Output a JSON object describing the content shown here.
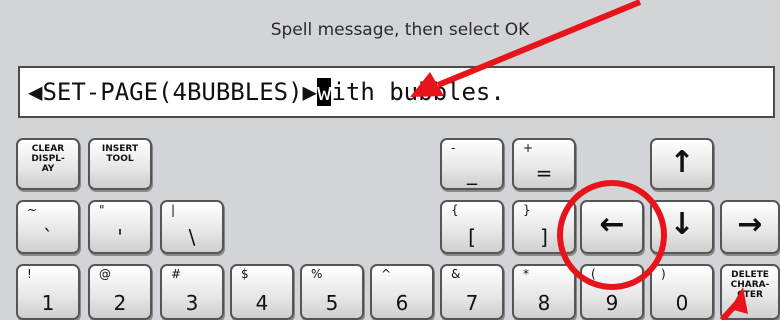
{
  "title": "Spell message, then select OK",
  "message": {
    "prefix": "◀SET-PAGE(4BUBBLES)▶",
    "cursor_char": "w",
    "suffix": "ith bubbles."
  },
  "keys": {
    "clear_display": "CLEAR\nDISPL-\nAY",
    "insert_tool": "INSERT\nTOOL",
    "minus": {
      "shift": "-",
      "main": "_"
    },
    "plus": {
      "shift": "+",
      "main": "="
    },
    "up": "↑",
    "tilde": {
      "shift": "~",
      "main": "`"
    },
    "quote": {
      "shift": "\"",
      "main": "'"
    },
    "pipe": {
      "shift": "|",
      "main": "\\"
    },
    "brace_open": {
      "shift": "{",
      "main": "["
    },
    "brace_close": {
      "shift": "}",
      "main": "]"
    },
    "left": "←",
    "down": "↓",
    "right": "→",
    "n1": {
      "shift": "!",
      "main": "1"
    },
    "n2": {
      "shift": "@",
      "main": "2"
    },
    "n3": {
      "shift": "#",
      "main": "3"
    },
    "n4": {
      "shift": "$",
      "main": "4"
    },
    "n5": {
      "shift": "%",
      "main": "5"
    },
    "n6": {
      "shift": "^",
      "main": "6"
    },
    "n7": {
      "shift": "&",
      "main": "7"
    },
    "n8": {
      "shift": "*",
      "main": "8"
    },
    "n9": {
      "shift": "(",
      "main": "9"
    },
    "n0": {
      "shift": ")",
      "main": "0"
    },
    "delete_character": "DELETE\nCHARA-\nCTER"
  },
  "colors": {
    "annotation": "#e8141b",
    "panel": "#d3d4d7"
  }
}
